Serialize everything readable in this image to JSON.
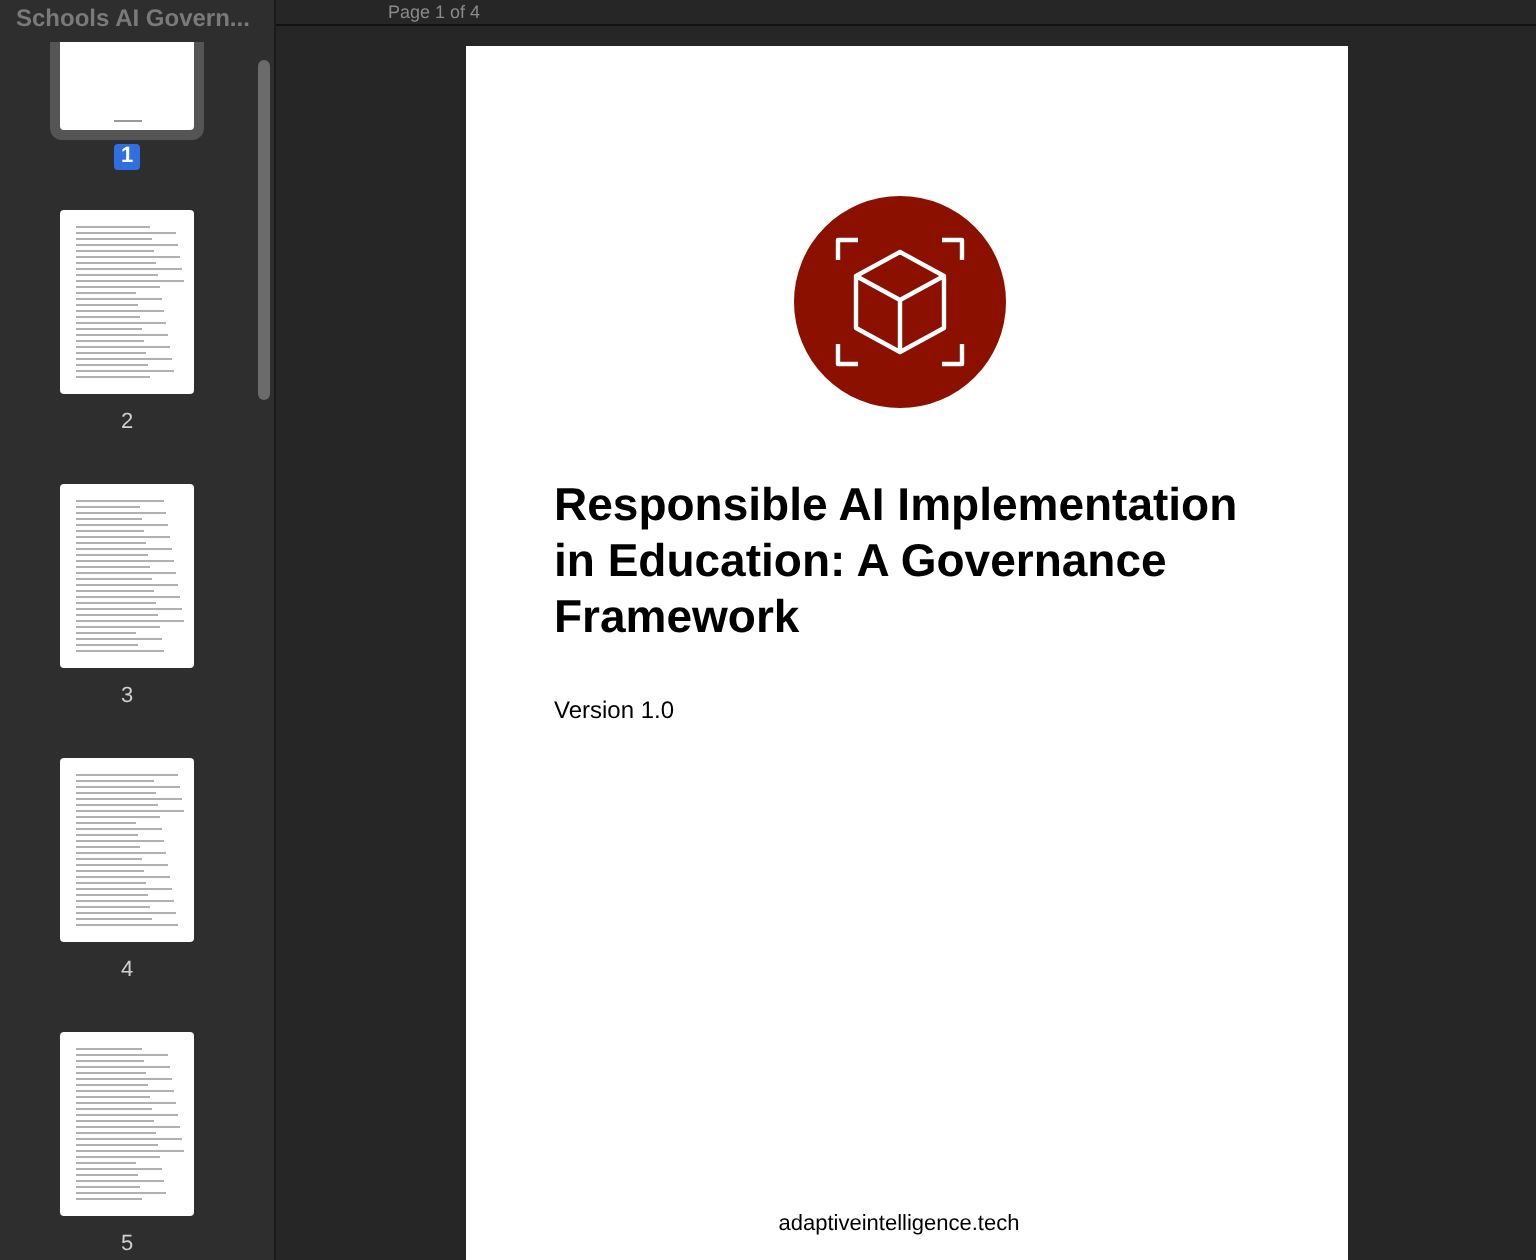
{
  "toolbar": {
    "page_indicator": "Page 1 of 4"
  },
  "sidebar": {
    "title": "Schools AI Govern...",
    "thumbnails": [
      {
        "label": "1",
        "selected": true
      },
      {
        "label": "2",
        "selected": false
      },
      {
        "label": "3",
        "selected": false
      },
      {
        "label": "4",
        "selected": false
      },
      {
        "label": "5",
        "selected": false
      }
    ]
  },
  "document_page": {
    "title": "Responsible AI Implementation in Education: A Governance Framework",
    "version": "Version 1.0",
    "footer": "adaptiveintelligence.tech"
  }
}
